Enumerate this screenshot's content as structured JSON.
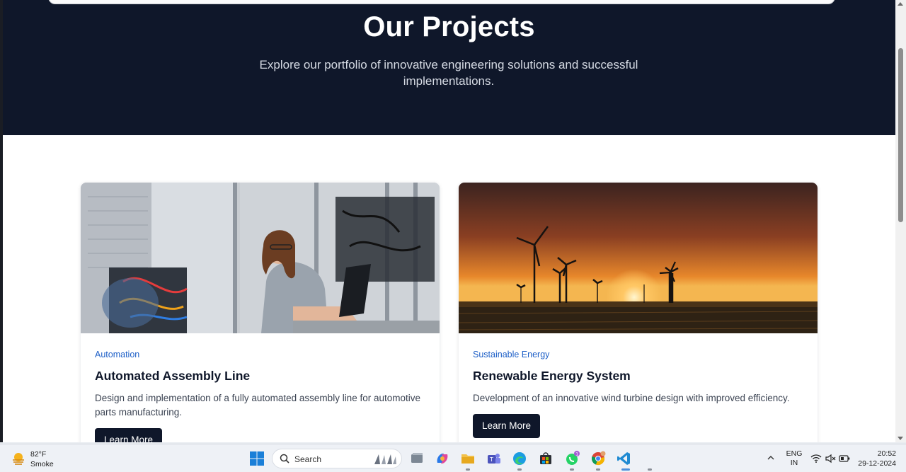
{
  "page": {
    "hero": {
      "title": "Our Projects",
      "subtitle": "Explore our portfolio of innovative engineering solutions and successful implementations."
    },
    "projects": [
      {
        "category": "Automation",
        "title": "Automated Assembly Line",
        "description": "Design and implementation of a fully automated assembly line for automotive parts manufacturing.",
        "button_label": "Learn More",
        "image": "engineer-at-laptop-in-automation-lab"
      },
      {
        "category": "Sustainable Energy",
        "title": "Renewable Energy System",
        "description": "Development of an innovative wind turbine design with improved efficiency.",
        "button_label": "Learn More",
        "image": "wind-turbines-at-sunset"
      }
    ]
  },
  "colors": {
    "hero_bg": "#0f172a",
    "accent": "#1d5fc7",
    "button_bg": "#0f172a"
  },
  "taskbar": {
    "weather": {
      "temp": "82°F",
      "condition": "Smoke",
      "icon": "weather-haze-icon"
    },
    "search_label": "Search",
    "apps": [
      "start-icon",
      "task-view-icon",
      "copilot-icon",
      "file-explorer-icon",
      "teams-icon",
      "edge-icon",
      "store-icon",
      "whatsapp-icon",
      "chrome-icon",
      "vscode-icon"
    ],
    "whatsapp_badge": "1",
    "language": {
      "line1": "ENG",
      "line2": "IN"
    },
    "clock": {
      "time": "20:52",
      "date": "29-12-2024"
    }
  }
}
